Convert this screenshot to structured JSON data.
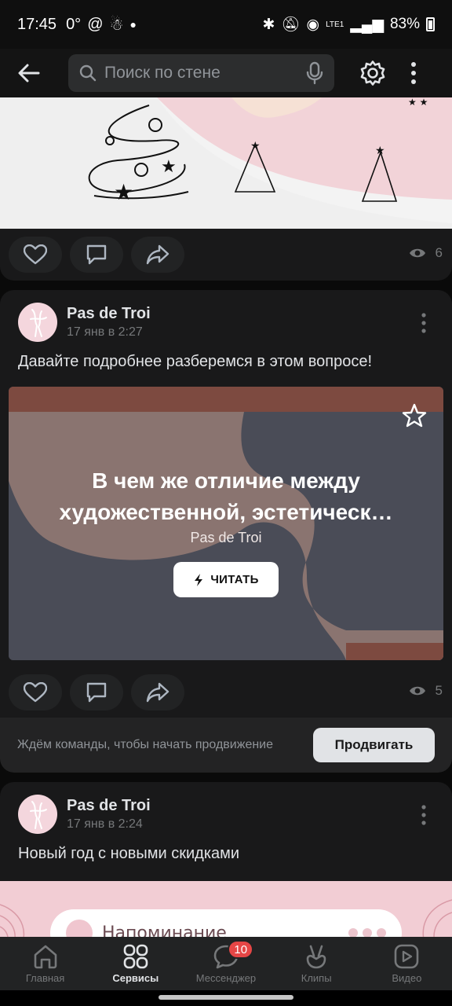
{
  "status_bar": {
    "time": "17:45",
    "temperature": "0°",
    "battery": "83%",
    "network": "LTE1"
  },
  "top_bar": {
    "search_placeholder": "Поиск по стене"
  },
  "posts": [
    {
      "views": "6"
    },
    {
      "author": "Pas de Troi",
      "date": "17 янв в 2:27",
      "text": "Давайте подробнее разберемся в этом вопросе!",
      "article": {
        "title": "В чем же отличие между художественной, эстетическ…",
        "author": "Pas de Troi",
        "read_label": "ЧИТАТЬ"
      },
      "views": "5",
      "promo": {
        "text": "Ждём команды, чтобы начать продвижение",
        "button": "Продвигать"
      }
    },
    {
      "author": "Pas de Troi",
      "date": "17 янв в 2:24",
      "text": "Новый год с новыми скидками",
      "image_text": "Напоминание"
    }
  ],
  "tab_bar": {
    "tabs": [
      {
        "label": "Главная",
        "icon": "home-icon"
      },
      {
        "label": "Сервисы",
        "icon": "services-icon"
      },
      {
        "label": "Мессенджер",
        "icon": "messenger-icon",
        "badge": "10"
      },
      {
        "label": "Клипы",
        "icon": "clips-icon"
      },
      {
        "label": "Видео",
        "icon": "video-icon"
      }
    ],
    "active_index": 1
  },
  "colors": {
    "background": "#0a0a0a",
    "card": "#19191a",
    "accent_badge": "#e64646",
    "article_pink": "#8a7470",
    "article_slate": "#4a4c57"
  }
}
